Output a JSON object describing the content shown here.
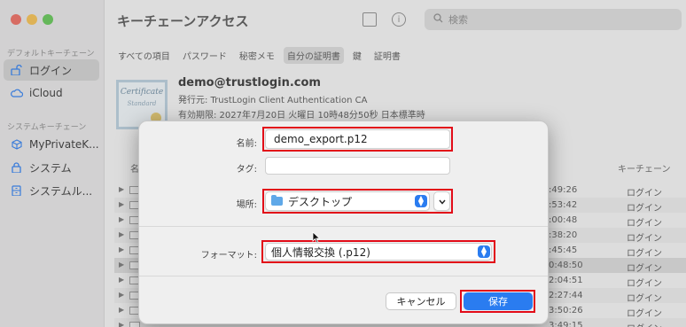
{
  "app": {
    "title": "キーチェーンアクセス",
    "search_placeholder": "検索",
    "traffic_colors": [
      "#ec6a5e",
      "#f4bf4f",
      "#61c554"
    ]
  },
  "sidebar": {
    "default_header": "デフォルトキーチェーン",
    "default_items": [
      {
        "label": "ログイン",
        "icon": "lock-open-icon",
        "selected": true
      },
      {
        "label": "iCloud",
        "icon": "cloud-icon",
        "selected": false
      }
    ],
    "system_header": "システムキーチェーン",
    "system_items": [
      {
        "label": "MyPrivateK...",
        "icon": "cube-icon"
      },
      {
        "label": "システム",
        "icon": "lock-icon"
      },
      {
        "label": "システムル...",
        "icon": "cabinet-icon"
      }
    ]
  },
  "tabs": [
    "すべての項目",
    "パスワード",
    "秘密メモ",
    "自分の証明書",
    "鍵",
    "証明書"
  ],
  "selected_tab_index": 3,
  "cert": {
    "image_text_1": "Certificate",
    "image_text_2": "Standard",
    "title": "demo@trustlogin.com",
    "issuer": "発行元: TrustLogin Client Authentication CA",
    "expiry": "有効期限: 2027年7月20日 火曜日 10時48分50秒 日本標準時"
  },
  "columns": {
    "name": "名",
    "keychain": "キーチェーン"
  },
  "rows": [
    {
      "time": ":49:26",
      "keychain": "ログイン"
    },
    {
      "time": ":53:42",
      "keychain": "ログイン"
    },
    {
      "time": ":00:48",
      "keychain": "ログイン"
    },
    {
      "time": ":38:20",
      "keychain": "ログイン"
    },
    {
      "time": ":45:45",
      "keychain": "ログイン"
    },
    {
      "time": "0:48:50",
      "keychain": "ログイン"
    },
    {
      "time": "2:04:51",
      "keychain": "ログイン"
    },
    {
      "time": "2:27:44",
      "keychain": "ログイン"
    },
    {
      "time": "3:50:26",
      "keychain": "ログイン"
    },
    {
      "time": "3:49:15",
      "keychain": "ログイン"
    }
  ],
  "dialog": {
    "name_label": "名前:",
    "name_value": "demo_export.p12",
    "tag_label": "タグ:",
    "tag_value": "",
    "location_label": "場所:",
    "location_value": "デスクトップ",
    "format_label": "フォーマット:",
    "format_value": "個人情報交換 (.p12)",
    "cancel_label": "キャンセル",
    "save_label": "保存"
  }
}
